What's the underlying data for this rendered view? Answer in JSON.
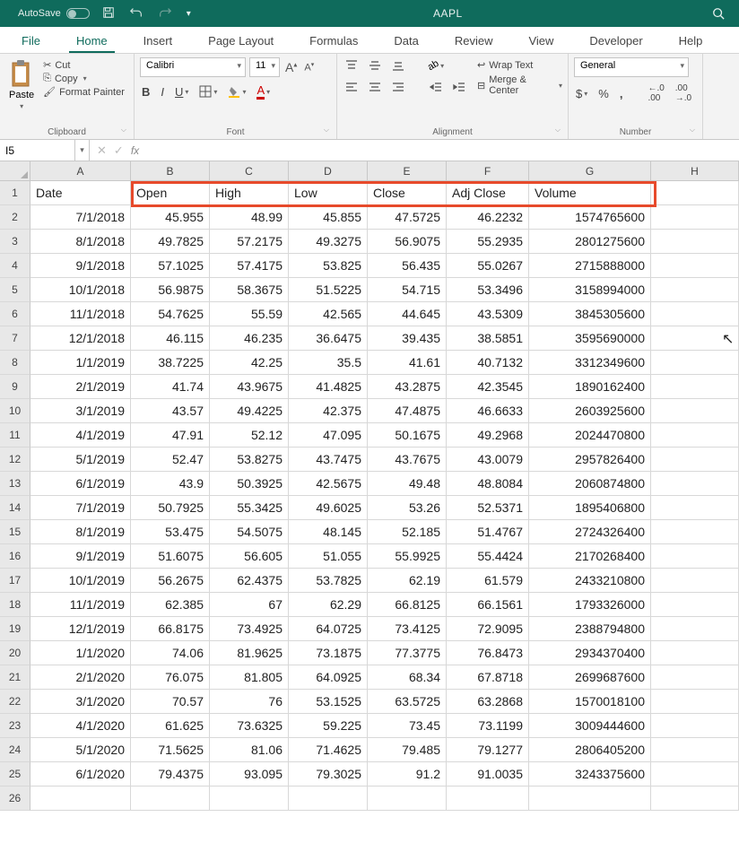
{
  "titlebar": {
    "autosave": "AutoSave",
    "title": "AAPL"
  },
  "tabs": {
    "file": "File",
    "home": "Home",
    "insert": "Insert",
    "page_layout": "Page Layout",
    "formulas": "Formulas",
    "data": "Data",
    "review": "Review",
    "view": "View",
    "developer": "Developer",
    "help": "Help"
  },
  "ribbon": {
    "clipboard": {
      "paste": "Paste",
      "cut": "Cut",
      "copy": "Copy",
      "fmtpainter": "Format Painter",
      "label": "Clipboard"
    },
    "font": {
      "name": "Calibri",
      "size": "11",
      "label": "Font"
    },
    "align": {
      "wrap": "Wrap Text",
      "merge": "Merge & Center",
      "label": "Alignment"
    },
    "number": {
      "fmt": "General",
      "label": "Number"
    }
  },
  "namebox": "I5",
  "columns": [
    "A",
    "B",
    "C",
    "D",
    "E",
    "F",
    "G",
    "H"
  ],
  "col_widths": {
    "A": 112,
    "B": 88,
    "C": 88,
    "D": 88,
    "E": 88,
    "F": 92,
    "G": 136,
    "H": 98
  },
  "header_row": [
    "Date",
    "Open",
    "High",
    "Low",
    "Close",
    "Adj Close",
    "Volume"
  ],
  "rows": [
    {
      "r": 2,
      "d": "7/1/2018",
      "o": "45.955",
      "h": "48.99",
      "l": "45.855",
      "c": "47.5725",
      "a": "46.2232",
      "v": "1574765600"
    },
    {
      "r": 3,
      "d": "8/1/2018",
      "o": "49.7825",
      "h": "57.2175",
      "l": "49.3275",
      "c": "56.9075",
      "a": "55.2935",
      "v": "2801275600"
    },
    {
      "r": 4,
      "d": "9/1/2018",
      "o": "57.1025",
      "h": "57.4175",
      "l": "53.825",
      "c": "56.435",
      "a": "55.0267",
      "v": "2715888000"
    },
    {
      "r": 5,
      "d": "10/1/2018",
      "o": "56.9875",
      "h": "58.3675",
      "l": "51.5225",
      "c": "54.715",
      "a": "53.3496",
      "v": "3158994000"
    },
    {
      "r": 6,
      "d": "11/1/2018",
      "o": "54.7625",
      "h": "55.59",
      "l": "42.565",
      "c": "44.645",
      "a": "43.5309",
      "v": "3845305600"
    },
    {
      "r": 7,
      "d": "12/1/2018",
      "o": "46.115",
      "h": "46.235",
      "l": "36.6475",
      "c": "39.435",
      "a": "38.5851",
      "v": "3595690000"
    },
    {
      "r": 8,
      "d": "1/1/2019",
      "o": "38.7225",
      "h": "42.25",
      "l": "35.5",
      "c": "41.61",
      "a": "40.7132",
      "v": "3312349600"
    },
    {
      "r": 9,
      "d": "2/1/2019",
      "o": "41.74",
      "h": "43.9675",
      "l": "41.4825",
      "c": "43.2875",
      "a": "42.3545",
      "v": "1890162400"
    },
    {
      "r": 10,
      "d": "3/1/2019",
      "o": "43.57",
      "h": "49.4225",
      "l": "42.375",
      "c": "47.4875",
      "a": "46.6633",
      "v": "2603925600"
    },
    {
      "r": 11,
      "d": "4/1/2019",
      "o": "47.91",
      "h": "52.12",
      "l": "47.095",
      "c": "50.1675",
      "a": "49.2968",
      "v": "2024470800"
    },
    {
      "r": 12,
      "d": "5/1/2019",
      "o": "52.47",
      "h": "53.8275",
      "l": "43.7475",
      "c": "43.7675",
      "a": "43.0079",
      "v": "2957826400"
    },
    {
      "r": 13,
      "d": "6/1/2019",
      "o": "43.9",
      "h": "50.3925",
      "l": "42.5675",
      "c": "49.48",
      "a": "48.8084",
      "v": "2060874800"
    },
    {
      "r": 14,
      "d": "7/1/2019",
      "o": "50.7925",
      "h": "55.3425",
      "l": "49.6025",
      "c": "53.26",
      "a": "52.5371",
      "v": "1895406800"
    },
    {
      "r": 15,
      "d": "8/1/2019",
      "o": "53.475",
      "h": "54.5075",
      "l": "48.145",
      "c": "52.185",
      "a": "51.4767",
      "v": "2724326400"
    },
    {
      "r": 16,
      "d": "9/1/2019",
      "o": "51.6075",
      "h": "56.605",
      "l": "51.055",
      "c": "55.9925",
      "a": "55.4424",
      "v": "2170268400"
    },
    {
      "r": 17,
      "d": "10/1/2019",
      "o": "56.2675",
      "h": "62.4375",
      "l": "53.7825",
      "c": "62.19",
      "a": "61.579",
      "v": "2433210800"
    },
    {
      "r": 18,
      "d": "11/1/2019",
      "o": "62.385",
      "h": "67",
      "l": "62.29",
      "c": "66.8125",
      "a": "66.1561",
      "v": "1793326000"
    },
    {
      "r": 19,
      "d": "12/1/2019",
      "o": "66.8175",
      "h": "73.4925",
      "l": "64.0725",
      "c": "73.4125",
      "a": "72.9095",
      "v": "2388794800"
    },
    {
      "r": 20,
      "d": "1/1/2020",
      "o": "74.06",
      "h": "81.9625",
      "l": "73.1875",
      "c": "77.3775",
      "a": "76.8473",
      "v": "2934370400"
    },
    {
      "r": 21,
      "d": "2/1/2020",
      "o": "76.075",
      "h": "81.805",
      "l": "64.0925",
      "c": "68.34",
      "a": "67.8718",
      "v": "2699687600"
    },
    {
      "r": 22,
      "d": "3/1/2020",
      "o": "70.57",
      "h": "76",
      "l": "53.1525",
      "c": "63.5725",
      "a": "63.2868",
      "v": "1570018100"
    },
    {
      "r": 23,
      "d": "4/1/2020",
      "o": "61.625",
      "h": "73.6325",
      "l": "59.225",
      "c": "73.45",
      "a": "73.1199",
      "v": "3009444600"
    },
    {
      "r": 24,
      "d": "5/1/2020",
      "o": "71.5625",
      "h": "81.06",
      "l": "71.4625",
      "c": "79.485",
      "a": "79.1277",
      "v": "2806405200"
    },
    {
      "r": 25,
      "d": "6/1/2020",
      "o": "79.4375",
      "h": "93.095",
      "l": "79.3025",
      "c": "91.2",
      "a": "91.0035",
      "v": "3243375600"
    }
  ],
  "empty_rows": [
    26
  ]
}
